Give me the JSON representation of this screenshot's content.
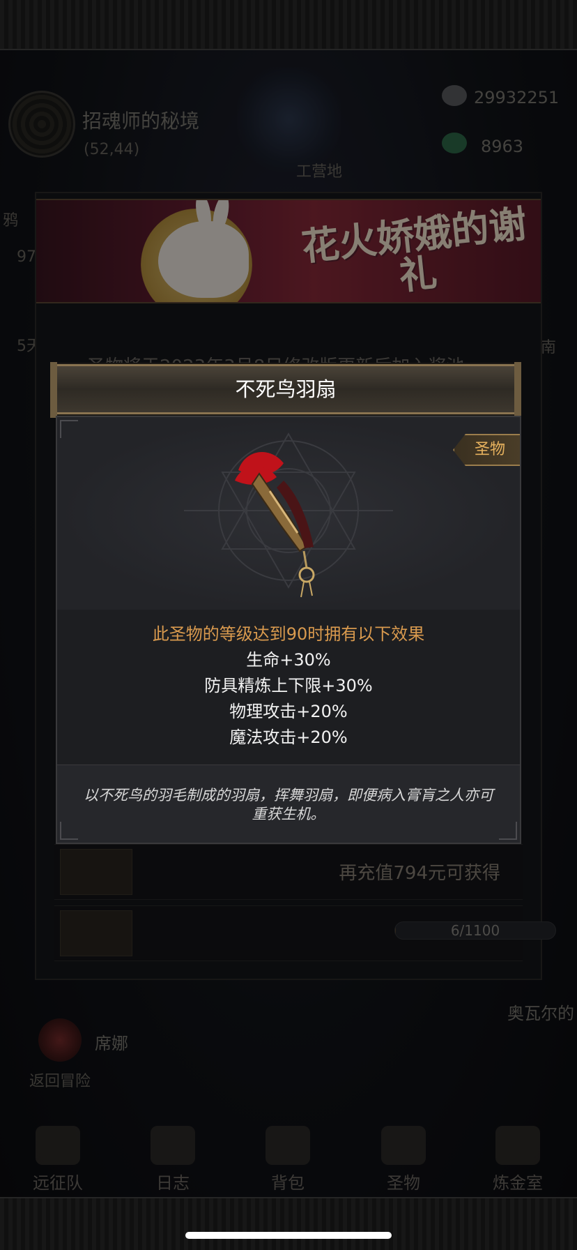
{
  "location": {
    "name": "招魂师的秘境",
    "coords": "(52,44)"
  },
  "camp_label": "工营地",
  "resources": [
    {
      "icon": "crystal-icon",
      "value": "29932251"
    },
    {
      "icon": "gem-icon",
      "value": "8963"
    }
  ],
  "left_edge": {
    "label1": "鸦",
    "label2": "97",
    "label3": "5天"
  },
  "right_edge": {
    "label1": "南"
  },
  "event": {
    "banner_title": "花火娇娥的谢礼",
    "note": "圣物将于2023年3月8日修改版更新后加入奖池。",
    "rewards": [
      {
        "text": "再充值794元可获得"
      },
      {
        "progress_text": "6/1100",
        "progress": 0.005
      }
    ]
  },
  "chat": {
    "npc_name": "奥瓦尔的",
    "player_name": "席娜"
  },
  "return_label": "返回冒险",
  "nav": [
    {
      "label": "远征队",
      "icon": "bull-skull-icon"
    },
    {
      "label": "日志",
      "icon": "journal-icon"
    },
    {
      "label": "背包",
      "icon": "backpack-icon"
    },
    {
      "label": "圣物",
      "icon": "relic-icon"
    },
    {
      "label": "炼金室",
      "icon": "alchemy-icon"
    }
  ],
  "modal": {
    "title": "不死鸟羽扇",
    "category": "圣物",
    "effect_heading": "此圣物的等级达到90时拥有以下效果",
    "effects": [
      "生命+30%",
      "防具精炼上下限+30%",
      "物理攻击+20%",
      "魔法攻击+20%"
    ],
    "description": "以不死鸟的羽毛制成的羽扇，挥舞羽扇，即便病入膏肓之人亦可重获生机。"
  },
  "colors": {
    "accent_gold": "#d99a4e",
    "tag_text": "#e7b25e",
    "feather_red": "#c0121a"
  }
}
